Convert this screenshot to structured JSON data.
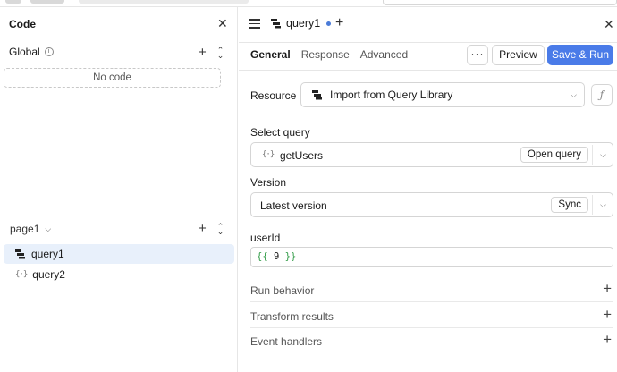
{
  "left_panel": {
    "title": "Code",
    "global_label": "Global",
    "no_code_text": "No code",
    "page_label": "page1",
    "queries": [
      {
        "label": "query1",
        "icon": "query-library-icon",
        "active": true
      },
      {
        "label": "query2",
        "icon": "braces-icon",
        "active": false
      }
    ]
  },
  "editor": {
    "tab_label": "query1",
    "tab_unsaved": true,
    "subtabs": [
      "General",
      "Response",
      "Advanced"
    ],
    "selected_subtab": "General",
    "more_label": "···",
    "preview_label": "Preview",
    "save_run_label": "Save & Run",
    "resource_label": "Resource",
    "resource_value": "Import from Query Library",
    "fx_label": "ƒ",
    "select_query_label": "Select query",
    "select_query_value": "getUsers",
    "open_query_label": "Open query",
    "version_label": "Version",
    "version_value": "Latest version",
    "sync_label": "Sync",
    "userid_label": "userId",
    "userid_code": {
      "open": "{{",
      "value": "9",
      "close": "}}"
    },
    "sections": [
      "Run behavior",
      "Transform results",
      "Event handlers"
    ]
  },
  "colors": {
    "accent": "#4a7be8",
    "active_row": "#e8f0fb",
    "code_brace": "#2e9a44"
  }
}
